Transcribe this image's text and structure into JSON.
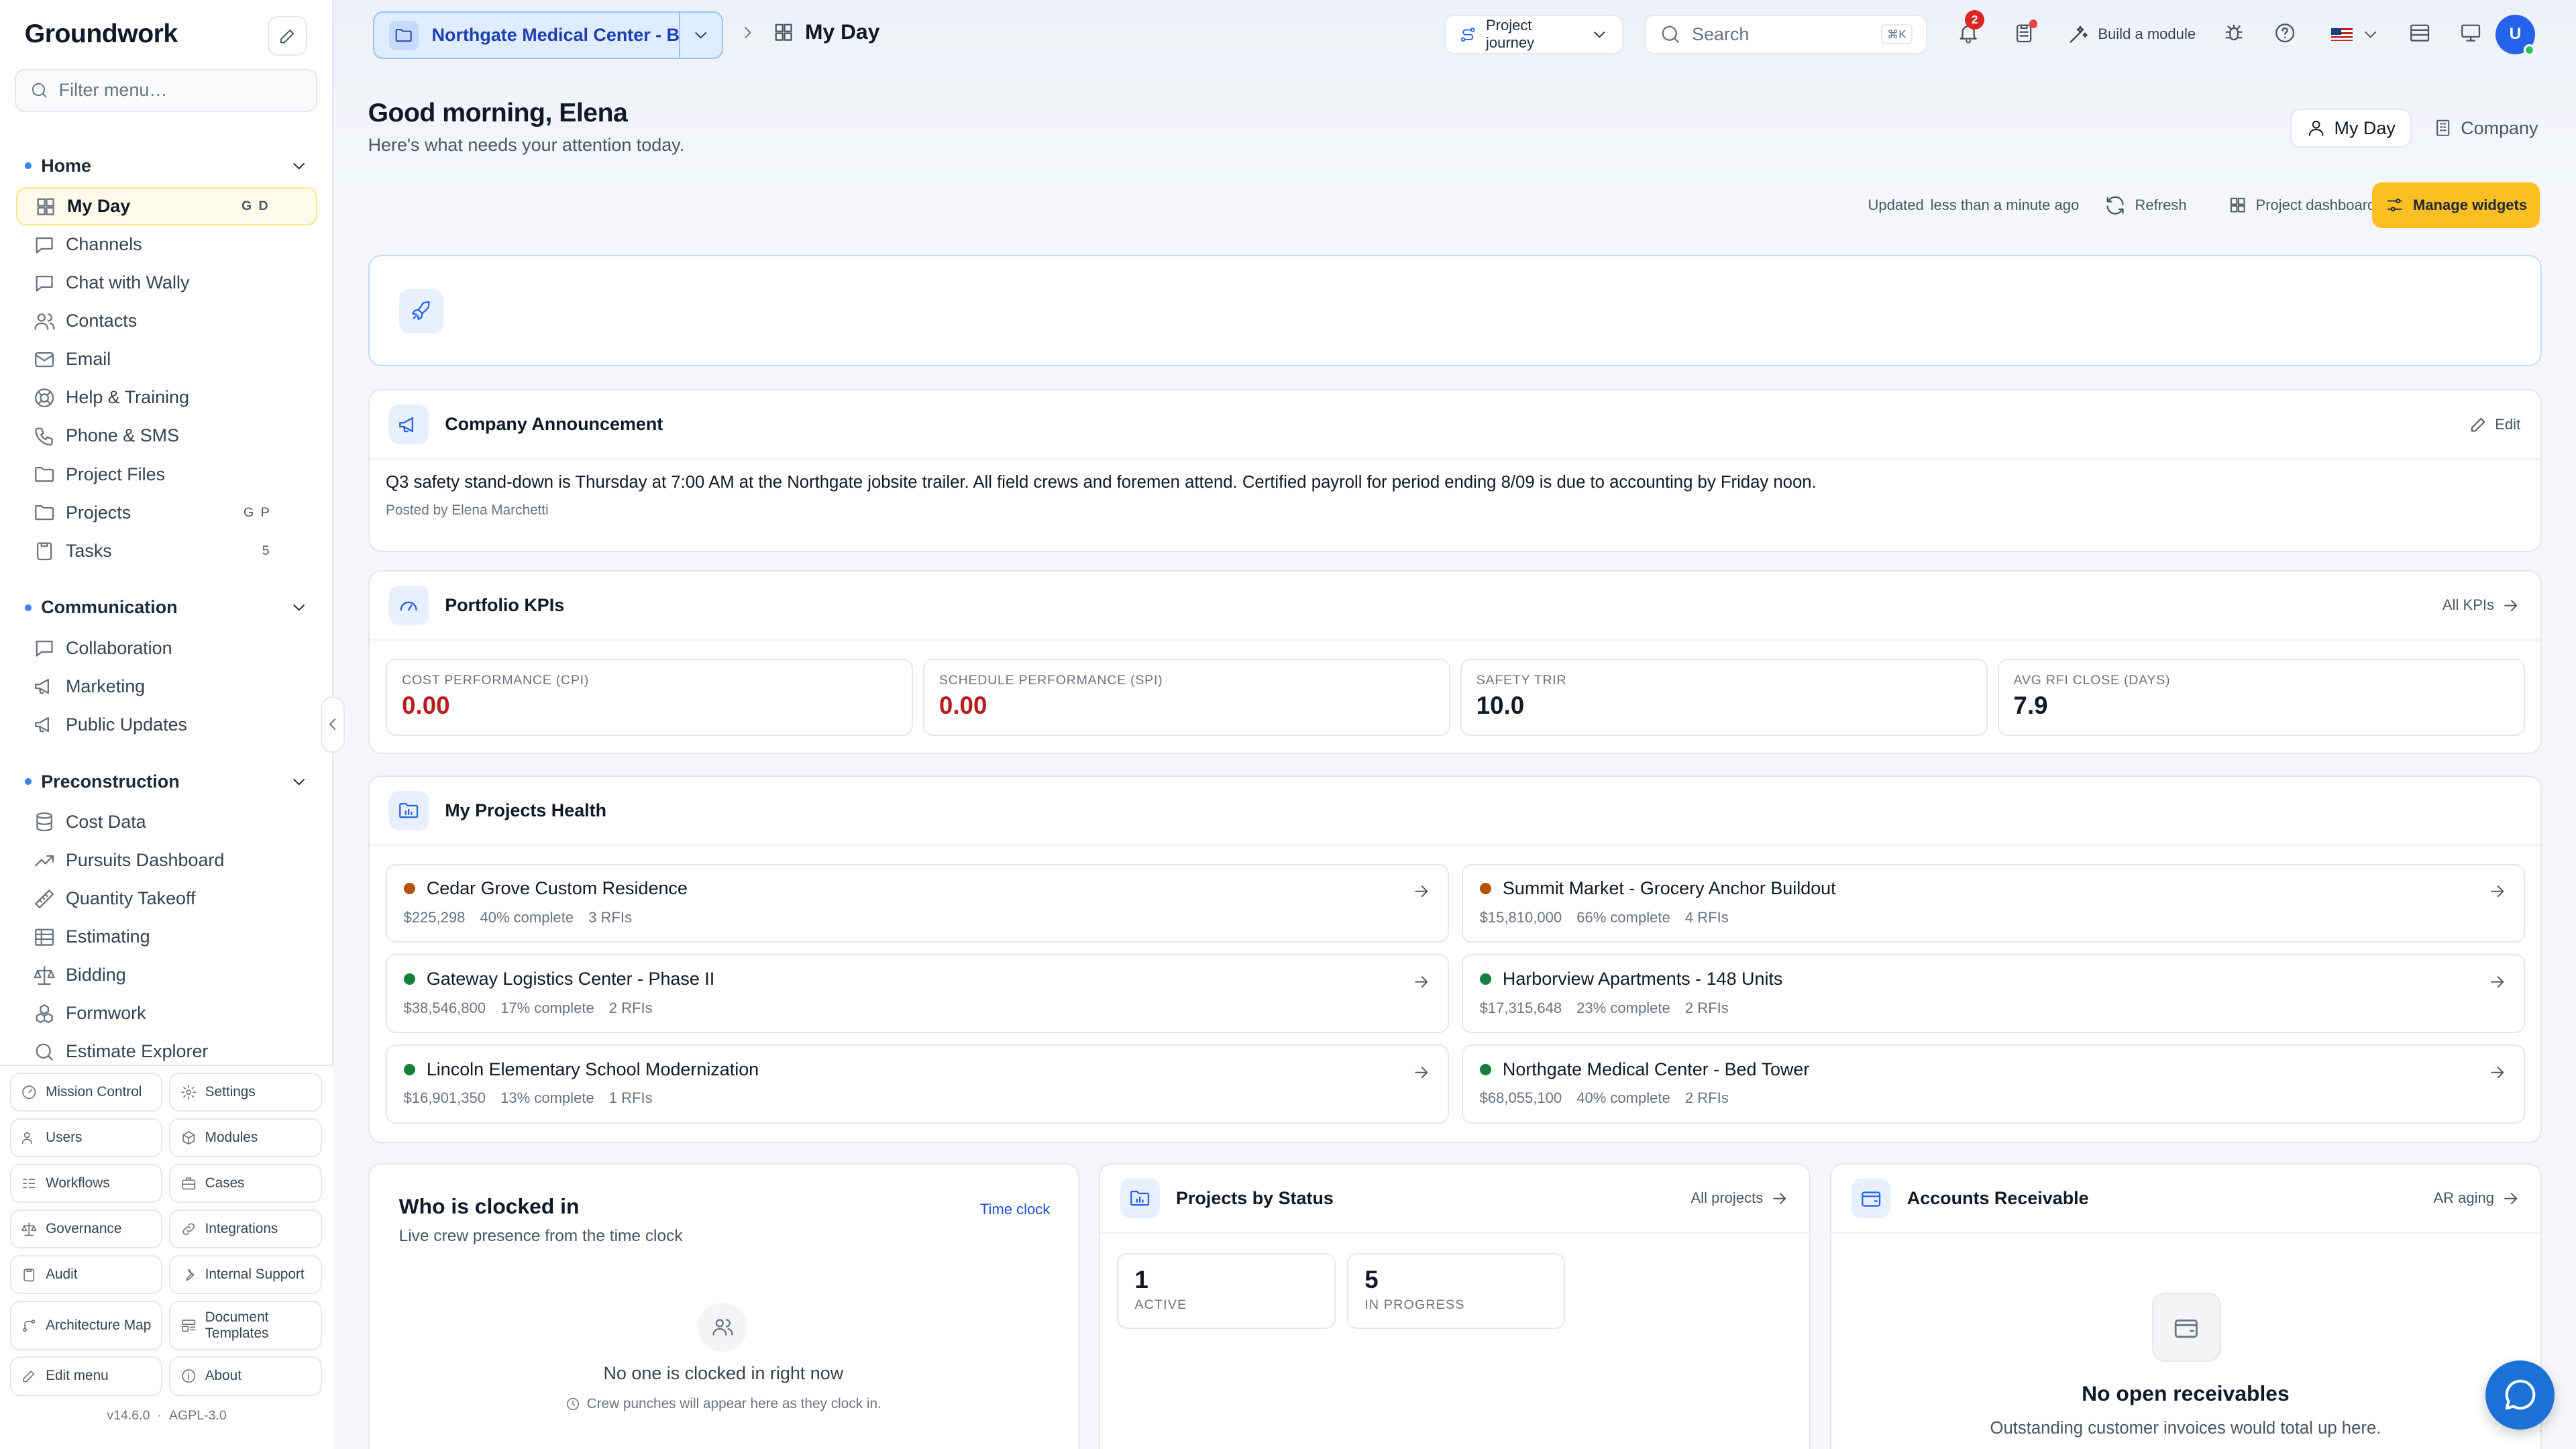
{
  "app": {
    "brand": "Groundwork",
    "version": "v14.6.0",
    "version_sep": "·",
    "license": "AGPL-3.0"
  },
  "sidebar": {
    "filter_placeholder": "Filter menu…",
    "sections": [
      {
        "label": "Home",
        "items": [
          {
            "label": "My Day",
            "shortcut": "G D",
            "icon": "grid-icon",
            "active": true
          },
          {
            "label": "Channels",
            "icon": "chat-icon"
          },
          {
            "label": "Chat with Wally",
            "icon": "chat-icon"
          },
          {
            "label": "Contacts",
            "icon": "users-icon"
          },
          {
            "label": "Email",
            "icon": "mail-icon"
          },
          {
            "label": "Help & Training",
            "icon": "lifebuoy-icon"
          },
          {
            "label": "Phone & SMS",
            "icon": "phone-icon"
          },
          {
            "label": "Project Files",
            "icon": "folder-icon"
          },
          {
            "label": "Projects",
            "shortcut": "G P",
            "icon": "folder-icon"
          },
          {
            "label": "Tasks",
            "shortcut": "5",
            "icon": "clipboard-icon"
          }
        ]
      },
      {
        "label": "Communication",
        "items": [
          {
            "label": "Collaboration",
            "icon": "chat-icon"
          },
          {
            "label": "Marketing",
            "icon": "megaphone-icon"
          },
          {
            "label": "Public Updates",
            "icon": "megaphone-icon"
          }
        ]
      },
      {
        "label": "Preconstruction",
        "items": [
          {
            "label": "Cost Data",
            "icon": "database-icon"
          },
          {
            "label": "Pursuits Dashboard",
            "icon": "trend-icon"
          },
          {
            "label": "Quantity Takeoff",
            "icon": "ruler-icon"
          },
          {
            "label": "Estimating",
            "icon": "table-icon"
          },
          {
            "label": "Bidding",
            "icon": "scale-icon"
          },
          {
            "label": "Formwork",
            "icon": "boxes-icon"
          },
          {
            "label": "Estimate Explorer",
            "icon": "search-icon"
          }
        ]
      }
    ],
    "bottom": [
      {
        "label": "Mission Control",
        "icon": "gauge-icon"
      },
      {
        "label": "Settings",
        "icon": "gear-icon"
      },
      {
        "label": "Users",
        "icon": "users-icon"
      },
      {
        "label": "Modules",
        "icon": "package-icon"
      },
      {
        "label": "Workflows",
        "icon": "workflow-icon"
      },
      {
        "label": "Cases",
        "icon": "briefcase-icon"
      },
      {
        "label": "Governance",
        "icon": "scale-icon"
      },
      {
        "label": "Integrations",
        "icon": "link-icon"
      },
      {
        "label": "Audit",
        "icon": "clipboard-icon"
      },
      {
        "label": "Internal Support",
        "icon": "wrench-icon"
      },
      {
        "label": "Architecture Map",
        "icon": "map-icon"
      },
      {
        "label": "Document Templates",
        "icon": "template-icon"
      },
      {
        "label": "Edit menu",
        "icon": "pencil-icon"
      },
      {
        "label": "About",
        "icon": "info-icon"
      }
    ]
  },
  "topbar": {
    "project": "Northgate Medical Center - B…",
    "page": "My Day",
    "journey": "Project journey",
    "search_placeholder": "Search",
    "search_kbd": "⌘K",
    "notif_count": "2",
    "build": "Build a module",
    "avatar": "U"
  },
  "header": {
    "greeting": "Good morning, Elena",
    "subtitle": "Here's what needs your attention today.",
    "tabs": [
      "My Day",
      "Company"
    ],
    "updated_label": "Updated",
    "updated_value": "less than a minute ago",
    "refresh": "Refresh",
    "dashboard": "Project dashboard",
    "manage": "Manage widgets"
  },
  "announcement": {
    "title": "Company Announcement",
    "edit": "Edit",
    "body": "Q3 safety stand-down is Thursday at 7:00 AM at the Northgate jobsite trailer. All field crews and foremen attend. Certified payroll for period ending 8/09 is due to accounting by Friday noon.",
    "posted_by": "Posted by Elena Marchetti"
  },
  "kpis": {
    "title": "Portfolio KPIs",
    "link": "All KPIs",
    "items": [
      {
        "label": "COST PERFORMANCE (CPI)",
        "value": "0.00",
        "color": "#b91c1c"
      },
      {
        "label": "SCHEDULE PERFORMANCE (SPI)",
        "value": "0.00",
        "color": "#b91c1c"
      },
      {
        "label": "SAFETY TRIR",
        "value": "10.0",
        "color": "#111827"
      },
      {
        "label": "AVG RFI CLOSE (DAYS)",
        "value": "7.9",
        "color": "#111827"
      }
    ]
  },
  "health": {
    "title": "My Projects Health",
    "projects": [
      {
        "name": "Cedar Grove Custom Residence",
        "value": "$225,298",
        "complete": "40% complete",
        "rfis": "3 RFIs",
        "status_color": "#b45309"
      },
      {
        "name": "Summit Market - Grocery Anchor Buildout",
        "value": "$15,810,000",
        "complete": "66% complete",
        "rfis": "4 RFIs",
        "status_color": "#b45309"
      },
      {
        "name": "Gateway Logistics Center - Phase II",
        "value": "$38,546,800",
        "complete": "17% complete",
        "rfis": "2 RFIs",
        "status_color": "#15803d"
      },
      {
        "name": "Harborview Apartments - 148 Units",
        "value": "$17,315,648",
        "complete": "23% complete",
        "rfis": "2 RFIs",
        "status_color": "#15803d"
      },
      {
        "name": "Lincoln Elementary School Modernization",
        "value": "$16,901,350",
        "complete": "13% complete",
        "rfis": "1 RFIs",
        "status_color": "#15803d"
      },
      {
        "name": "Northgate Medical Center - Bed Tower",
        "value": "$68,055,100",
        "complete": "40% complete",
        "rfis": "2 RFIs",
        "status_color": "#15803d"
      }
    ]
  },
  "clock": {
    "title": "Who is clocked in",
    "subtitle": "Live crew presence from the time clock",
    "link": "Time clock",
    "empty": "No one is clocked in right now",
    "hint": "Crew punches will appear here as they clock in."
  },
  "status": {
    "title": "Projects by Status",
    "link": "All projects",
    "items": [
      {
        "count": "1",
        "label": "ACTIVE"
      },
      {
        "count": "5",
        "label": "IN PROGRESS"
      }
    ]
  },
  "ar": {
    "title": "Accounts Receivable",
    "link": "AR aging",
    "empty": "No open receivables",
    "hint": "Outstanding customer invoices would total up here."
  },
  "colors": {
    "accent": "#2563eb",
    "warning_button": "#fbbf24",
    "red": "#b91c1c",
    "green": "#15803d",
    "amber": "#b45309"
  }
}
